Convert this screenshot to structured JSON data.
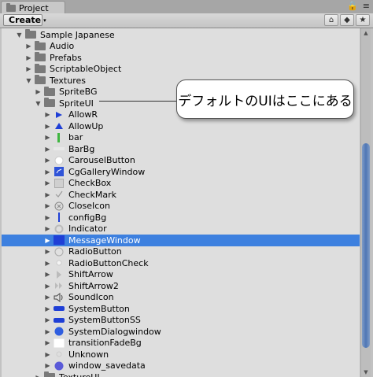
{
  "window": {
    "tab_label": "Project",
    "menu_glyph": "≡"
  },
  "toolbar": {
    "create_label": "Create",
    "create_arrow": "▾",
    "icons": [
      "tag-icon",
      "filter-icon",
      "star-icon"
    ]
  },
  "tree": {
    "items": [
      {
        "label": "Sample Japanese",
        "indent": 0,
        "expanded": true,
        "kind": "folder"
      },
      {
        "label": "Audio",
        "indent": 1,
        "expanded": false,
        "kind": "folder"
      },
      {
        "label": "Prefabs",
        "indent": 1,
        "expanded": false,
        "kind": "folder"
      },
      {
        "label": "ScriptableObject",
        "indent": 1,
        "expanded": false,
        "kind": "folder"
      },
      {
        "label": "Textures",
        "indent": 1,
        "expanded": true,
        "kind": "folder"
      },
      {
        "label": "SpriteBG",
        "indent": 2,
        "expanded": false,
        "kind": "folder"
      },
      {
        "label": "SpriteUI",
        "indent": 2,
        "expanded": true,
        "kind": "folder"
      },
      {
        "label": "AllowR",
        "indent": 3,
        "kind": "sprite",
        "icon": "arrow-right-icon",
        "color": "#1f3fd6"
      },
      {
        "label": "AllowUp",
        "indent": 3,
        "kind": "sprite",
        "icon": "arrow-up-icon",
        "color": "#1f3fd6"
      },
      {
        "label": "bar",
        "indent": 3,
        "kind": "sprite",
        "icon": "bar-icon",
        "color": "#3fb640"
      },
      {
        "label": "BarBg",
        "indent": 3,
        "kind": "sprite",
        "icon": "barbg-icon",
        "color": "#e8e8e8"
      },
      {
        "label": "CarouselButton",
        "indent": 3,
        "kind": "sprite",
        "icon": "circle-icon",
        "color": "#ffffff"
      },
      {
        "label": "CgGalleryWindow",
        "indent": 3,
        "kind": "sprite",
        "icon": "gallery-icon",
        "color": "#2f53d8"
      },
      {
        "label": "CheckBox",
        "indent": 3,
        "kind": "sprite",
        "icon": "checkbox-icon",
        "color": "#cfcfcf"
      },
      {
        "label": "CheckMark",
        "indent": 3,
        "kind": "sprite",
        "icon": "checkmark-icon",
        "color": "#999999"
      },
      {
        "label": "CloseIcon",
        "indent": 3,
        "kind": "sprite",
        "icon": "close-icon",
        "color": "#888888"
      },
      {
        "label": "configBg",
        "indent": 3,
        "kind": "sprite",
        "icon": "config-bg-icon",
        "color": "#1f3fd6"
      },
      {
        "label": "Indicator",
        "indent": 3,
        "kind": "sprite",
        "icon": "indicator-icon",
        "color": "#bbbbbb"
      },
      {
        "label": "MessageWindow",
        "indent": 3,
        "kind": "sprite",
        "icon": "message-window-icon",
        "color": "#1f3fd6",
        "selected": true
      },
      {
        "label": "RadioButton",
        "indent": 3,
        "kind": "sprite",
        "icon": "radio-icon",
        "color": "#e0e0e0"
      },
      {
        "label": "RadioButtonCheck",
        "indent": 3,
        "kind": "sprite",
        "icon": "radio-check-icon",
        "color": "#f4f4f4"
      },
      {
        "label": "ShiftArrow",
        "indent": 3,
        "kind": "sprite",
        "icon": "shift-arrow-icon",
        "color": "#bbbbbb"
      },
      {
        "label": "ShiftArrow2",
        "indent": 3,
        "kind": "sprite",
        "icon": "shift-arrow2-icon",
        "color": "#bbbbbb"
      },
      {
        "label": "SoundIcon",
        "indent": 3,
        "kind": "sprite",
        "icon": "speaker-icon",
        "color": "#444444"
      },
      {
        "label": "SystemButton",
        "indent": 3,
        "kind": "sprite",
        "icon": "system-button-icon",
        "color": "#1f3fd6"
      },
      {
        "label": "SystemButtonSS",
        "indent": 3,
        "kind": "sprite",
        "icon": "system-button-ss-icon",
        "color": "#1f3fd6"
      },
      {
        "label": "SystemDialogwindow",
        "indent": 3,
        "kind": "sprite",
        "icon": "dialog-icon",
        "color": "#2f5ee0"
      },
      {
        "label": "transitionFadeBg",
        "indent": 3,
        "kind": "sprite",
        "icon": "fade-bg-icon",
        "color": "#ffffff"
      },
      {
        "label": "Unknown",
        "indent": 3,
        "kind": "sprite",
        "icon": "unknown-icon",
        "color": "#cccccc"
      },
      {
        "label": "window_savedata",
        "indent": 3,
        "kind": "sprite",
        "icon": "savedata-icon",
        "color": "#5a5ad8"
      },
      {
        "label": "TextureUI",
        "indent": 2,
        "expanded": false,
        "kind": "folder"
      }
    ]
  },
  "callout": {
    "text": "デフォルトのUIはここにある"
  }
}
